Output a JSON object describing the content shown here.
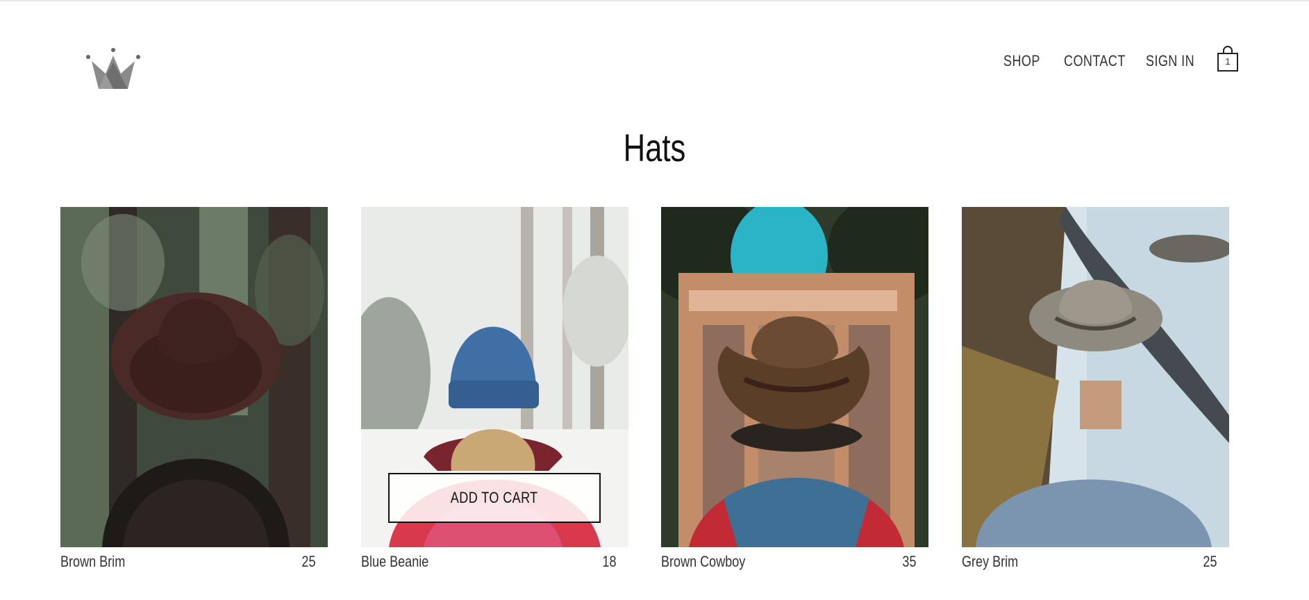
{
  "header": {
    "logo_icon": "crown-icon",
    "nav": {
      "shop": "SHOP",
      "contact": "CONTACT",
      "sign_in": "SIGN IN"
    },
    "cart": {
      "icon": "shopping-bag-icon",
      "count": "1"
    }
  },
  "page": {
    "title": "Hats"
  },
  "products": [
    {
      "name": "Brown Brim",
      "price": "25"
    },
    {
      "name": "Blue Beanie",
      "price": "18",
      "button": "ADD TO CART"
    },
    {
      "name": "Brown Cowboy",
      "price": "35"
    },
    {
      "name": "Grey Brim",
      "price": "25"
    }
  ],
  "colors": {
    "text": "#333333",
    "title": "#111111",
    "logo": "#808080"
  }
}
